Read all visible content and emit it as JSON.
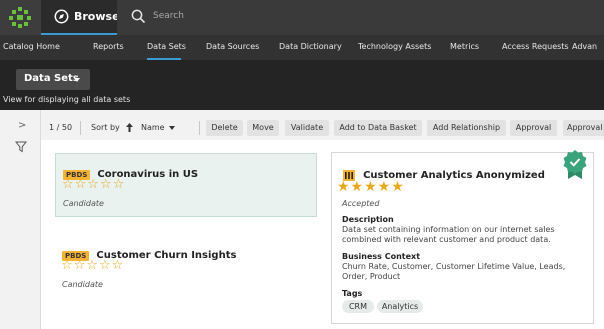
{
  "topbar": {
    "browse_label": "Browse",
    "search_placeholder": "Search",
    "icons": [
      "app-logo-icon",
      "compass-icon",
      "search-icon"
    ]
  },
  "nav": {
    "items": [
      "Catalog Home",
      "Reports",
      "Data Sets",
      "Data Sources",
      "Data Dictionary",
      "Technology Assets",
      "Metrics",
      "Access Requests",
      "Advan"
    ],
    "active": "Data Sets"
  },
  "header": {
    "dropdown_label": "Data Sets",
    "description": "View for displaying all data sets"
  },
  "toolbar": {
    "count": "1 / 50",
    "sort_label": "Sort by",
    "sort_field": "Name",
    "buttons": [
      "Delete",
      "Move",
      "Validate",
      "Add to Data Basket",
      "Add Relationship",
      "Approval",
      "Approval"
    ]
  },
  "cards": [
    {
      "badge": "PBDS",
      "title": "Coronavirus in US",
      "rating": 0,
      "status": "Candidate"
    },
    {
      "badge": "PBDS",
      "title": "Customer Churn Insights",
      "rating": 0,
      "status": "Candidate"
    }
  ],
  "detail": {
    "title": "Customer Analytics Anonymized",
    "rating": 5,
    "status": "Accepted",
    "description_label": "Description",
    "description": "Data set containing information on our internet sales combined with relevant customer and product data.",
    "business_context_label": "Business Context",
    "business_context": "Churn Rate, Customer, Customer Lifetime Value, Leads, Order, Product",
    "tags_label": "Tags",
    "tags": [
      "CRM",
      "Analytics"
    ]
  },
  "colors": {
    "accent": "#3d9ad1",
    "badge": "#f5b335",
    "star": "#e8a81c",
    "certified": "#3aa37c"
  },
  "stars": {
    "empty": "☆☆☆☆☆",
    "full": "★★★★★"
  }
}
